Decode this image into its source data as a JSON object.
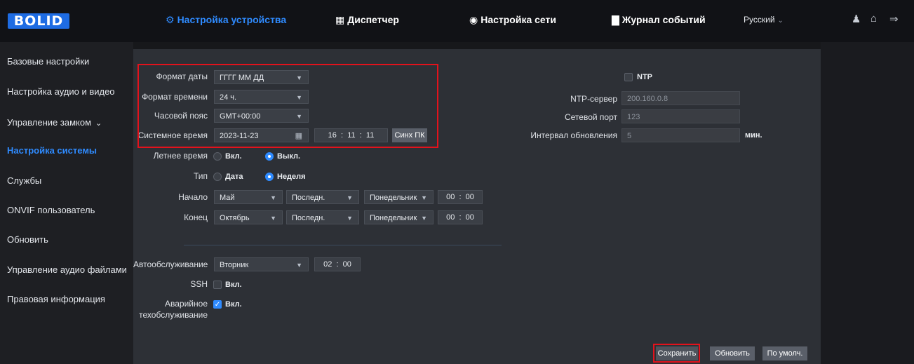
{
  "app": {
    "logo": "BOLID",
    "tabs": [
      {
        "label": "Настройка устройства",
        "icon": "gear-icon",
        "glyph": "⚙"
      },
      {
        "label": "Диспетчер",
        "icon": "grid-icon",
        "glyph": "▦"
      },
      {
        "label": "Настройка сети",
        "icon": "globe-icon",
        "glyph": "◉"
      },
      {
        "label": "Журнал событий",
        "icon": "journal-icon",
        "glyph": "▇"
      }
    ],
    "language": "Русский"
  },
  "sidebar": {
    "items": [
      {
        "label": "Базовые настройки"
      },
      {
        "label": "Настройка аудио и видео"
      },
      {
        "label": "Управление замком",
        "chevron": "⌄"
      },
      {
        "label": "Настройка системы"
      },
      {
        "label": "Службы"
      },
      {
        "label": "ONVIF пользователь"
      },
      {
        "label": "Обновить"
      },
      {
        "label": "Управление аудио файлами"
      },
      {
        "label": "Правовая информация"
      }
    ]
  },
  "form": {
    "date_format": {
      "label": "Формат даты",
      "value": "ГГГГ ММ ДД"
    },
    "time_format": {
      "label": "Формат времени",
      "value": "24 ч."
    },
    "timezone": {
      "label": "Часовой пояс",
      "value": "GMT+00:00"
    },
    "system_time": {
      "label": "Системное время",
      "date": "2023-11-23",
      "hh": "16",
      "mm": "11",
      "ss": "11",
      "sync_label": "Синх ПК"
    },
    "dst": {
      "label": "Летнее время",
      "on_label": "Вкл.",
      "off_label": "Выкл.",
      "selected": "off"
    },
    "type": {
      "label": "Тип",
      "date_label": "Дата",
      "week_label": "Неделя",
      "selected": "week"
    },
    "start": {
      "label": "Начало",
      "month": "Май",
      "week": "Последн.",
      "day": "Понедельник",
      "hh": "00",
      "mm": "00"
    },
    "end": {
      "label": "Конец",
      "month": "Октябрь",
      "week": "Последн.",
      "day": "Понедельник",
      "hh": "00",
      "mm": "00"
    },
    "maintenance": {
      "label": "Автообслуживание",
      "day": "Вторник",
      "hh": "02",
      "mm": "00"
    },
    "ssh": {
      "label": "SSH",
      "option": "Вкл.",
      "checked": false
    },
    "emergency": {
      "label_line1": "Аварийное",
      "label_line2": "техобслуживание",
      "option": "Вкл.",
      "checked": true
    },
    "ntp": {
      "label": "NTP",
      "enabled": false
    },
    "ntp_server": {
      "label": "NTP-сервер",
      "value": "200.160.0.8"
    },
    "port": {
      "label": "Сетевой порт",
      "value": "123"
    },
    "interval": {
      "label": "Интервал обновления",
      "value": "5",
      "unit": "мин."
    }
  },
  "buttons": {
    "save": "Сохранить",
    "refresh": "Обновить",
    "default": "По умолч."
  },
  "colors": {
    "accent": "#2f8bff",
    "highlight": "#e3121c",
    "logo_bg": "#1e6ce3"
  }
}
